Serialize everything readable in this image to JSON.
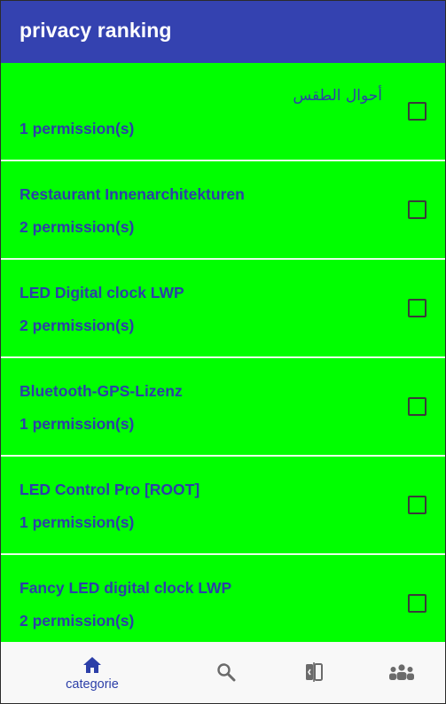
{
  "appbar": {
    "title": "privacy ranking"
  },
  "apps": [
    {
      "title": "أحوال الطقس",
      "permissions": "1 permission(s)",
      "checked": false
    },
    {
      "title": "Restaurant Innenarchitekturen",
      "permissions": "2 permission(s)",
      "checked": false
    },
    {
      "title": "LED Digital clock LWP",
      "permissions": "2 permission(s)",
      "checked": false
    },
    {
      "title": "Bluetooth-GPS-Lizenz",
      "permissions": "1 permission(s)",
      "checked": false
    },
    {
      "title": "LED Control Pro [ROOT]",
      "permissions": "1 permission(s)",
      "checked": false
    },
    {
      "title": "Fancy LED digital clock LWP",
      "permissions": "2 permission(s)",
      "checked": false
    }
  ],
  "bottom_nav": {
    "items": [
      {
        "label": "categorie",
        "icon": "home-icon",
        "active": true
      },
      {
        "label": "",
        "icon": "search-icon",
        "active": false
      },
      {
        "label": "",
        "icon": "compare-icon",
        "active": false
      },
      {
        "label": "",
        "icon": "group-icon",
        "active": false
      }
    ]
  },
  "colors": {
    "appbar": "#3442b0",
    "list_background": "#00ff00",
    "text": "#2c3fa8",
    "nav_background": "#f8f8f8",
    "nav_active": "#2c3fa8",
    "nav_inactive": "#6b6b6b"
  }
}
